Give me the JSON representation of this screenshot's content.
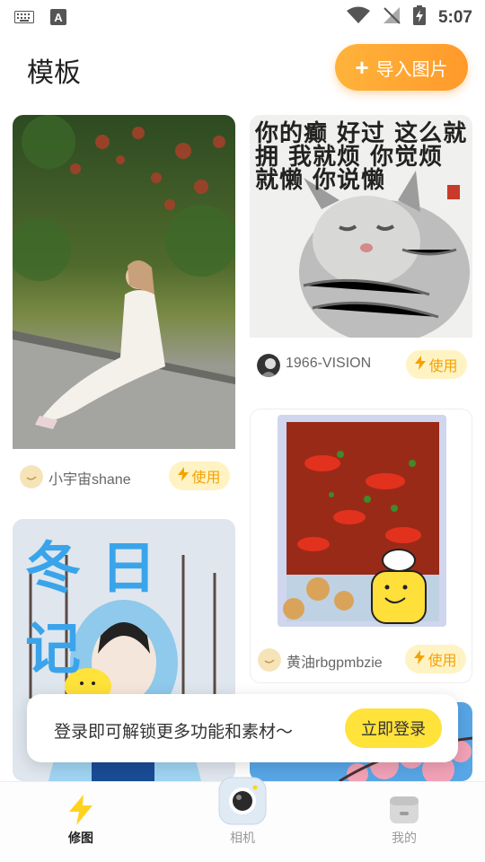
{
  "status_bar": {
    "time": "5:07"
  },
  "header": {
    "title": "模板",
    "import_label": "导入图片"
  },
  "templates": [
    {
      "author": "小宇宙shane",
      "use_label": "使用"
    },
    {
      "author": "1966-VISION",
      "use_label": "使用"
    },
    {
      "author": "黄油rbgpmbzie",
      "use_label": "使用"
    },
    {
      "title_text": "冬日记"
    }
  ],
  "cat_caption": "你的癫 好过 这么就拥 我就烦 你觉烦 就懒 你说懒",
  "login_banner": {
    "text": "登录即可解锁更多功能和素材～",
    "button_label": "立即登录"
  },
  "bottom_nav": [
    {
      "label": "修图",
      "active": true
    },
    {
      "label": "相机",
      "active": false
    },
    {
      "label": "我的",
      "active": false
    }
  ],
  "colors": {
    "accent_orange": "#ff9a2a",
    "use_yellow": "#f5a200",
    "login_yellow": "#ffe23a"
  }
}
